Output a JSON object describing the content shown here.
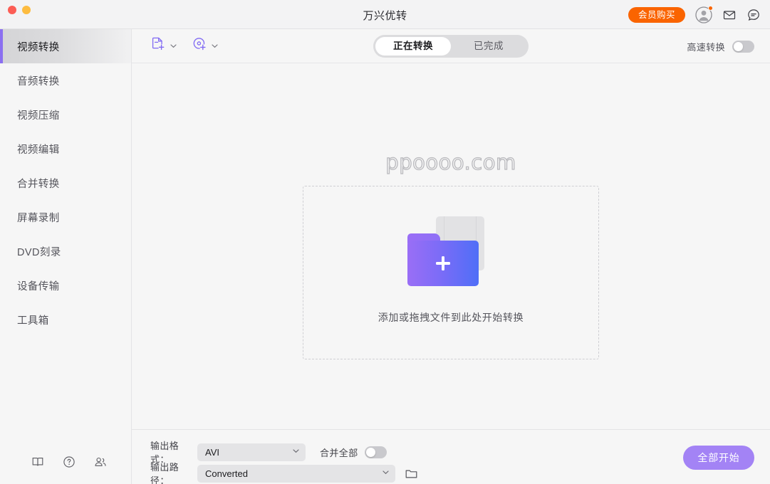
{
  "window": {
    "title": "万兴优转",
    "traffic_lights": [
      "close-red",
      "minimize-yellow"
    ]
  },
  "titlebar": {
    "buy_label": "会员购买",
    "icons": [
      "user-avatar-icon",
      "mail-icon",
      "chat-support-icon"
    ],
    "accent_orange": "#fa6400"
  },
  "sidebar": {
    "items": [
      {
        "label": "视频转换",
        "active": true
      },
      {
        "label": "音频转换",
        "active": false
      },
      {
        "label": "视频压缩",
        "active": false
      },
      {
        "label": "视频编辑",
        "active": false
      },
      {
        "label": "合并转换",
        "active": false
      },
      {
        "label": "屏幕录制",
        "active": false
      },
      {
        "label": "DVD刻录",
        "active": false
      },
      {
        "label": "设备传输",
        "active": false
      },
      {
        "label": "工具箱",
        "active": false
      }
    ],
    "bottom_icons": [
      "book-icon",
      "help-icon",
      "community-icon"
    ],
    "active_accent": "#8b6ff0"
  },
  "toolbar": {
    "add_file_icon": "add-file-icon",
    "add_disc_icon": "add-disc-icon",
    "tabs": [
      {
        "label": "正在转换",
        "active": true
      },
      {
        "label": "已完成",
        "active": false
      }
    ],
    "highspeed_label": "高速转换",
    "highspeed_on": false
  },
  "canvas": {
    "watermark": "ppoooo.com",
    "drop_text": "添加或拖拽文件到此处开始转换",
    "folder_gradient_from": "#9a6ef6",
    "folder_gradient_to": "#4f6ef7"
  },
  "bottombar": {
    "format_label": "输出格式：",
    "format_value": "AVI",
    "merge_label": "合并全部",
    "merge_on": false,
    "path_label": "输出路径：",
    "path_value": "Converted",
    "folder_icon": "open-folder-icon",
    "start_label": "全部开始",
    "start_color": "#a383f5"
  }
}
